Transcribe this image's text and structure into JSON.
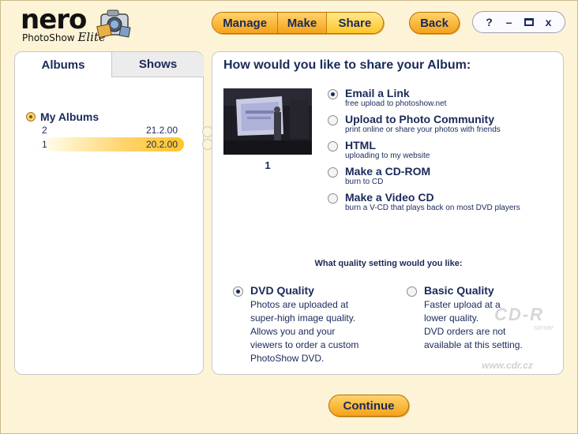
{
  "logo": {
    "brand": "nero",
    "product": "PhotoShow",
    "edition": "Elite"
  },
  "nav": {
    "manage": "Manage",
    "make": "Make",
    "share": "Share",
    "back": "Back"
  },
  "window_controls": {
    "help": "?",
    "minimize": "–",
    "close": "x"
  },
  "left_tabs": {
    "albums": "Albums",
    "shows": "Shows"
  },
  "tree": {
    "root_label": "My Albums",
    "albums": [
      {
        "name": "2",
        "date": "21.2.00"
      },
      {
        "name": "1",
        "date": "20.2.00",
        "selected": true
      }
    ]
  },
  "share": {
    "title": "How would you like to share your Album:",
    "thumbnail_caption": "1",
    "options": [
      {
        "title": "Email a Link",
        "desc": "free upload to photoshow.net",
        "selected": true
      },
      {
        "title": "Upload to Photo Community",
        "desc": "print online or share your photos with friends",
        "selected": false
      },
      {
        "title": "HTML",
        "desc": "uploading to my website",
        "selected": false
      },
      {
        "title": "Make a CD-ROM",
        "desc": "burn to CD",
        "selected": false
      },
      {
        "title": "Make a Video CD",
        "desc": "burn a V-CD that plays back on most DVD players",
        "selected": false
      }
    ]
  },
  "quality": {
    "question": "What quality setting would you like:",
    "dvd": {
      "title": "DVD Quality",
      "lines": [
        "Photos are uploaded at",
        "super-high image quality.",
        "Allows you and your",
        "viewers to order a custom",
        "PhotoShow DVD."
      ],
      "selected": true
    },
    "basic": {
      "title": "Basic Quality",
      "lines": [
        "Faster upload at a",
        "lower quality.",
        "DVD orders are not",
        "available at this setting."
      ],
      "selected": false
    }
  },
  "watermark": {
    "logo": "CD-R",
    "sub": "server",
    "url": "www.cdr.cz"
  },
  "continue_label": "Continue",
  "colors": {
    "background": "#fdf3d6",
    "button": "#f5a21a",
    "text": "#1a2a5a"
  }
}
